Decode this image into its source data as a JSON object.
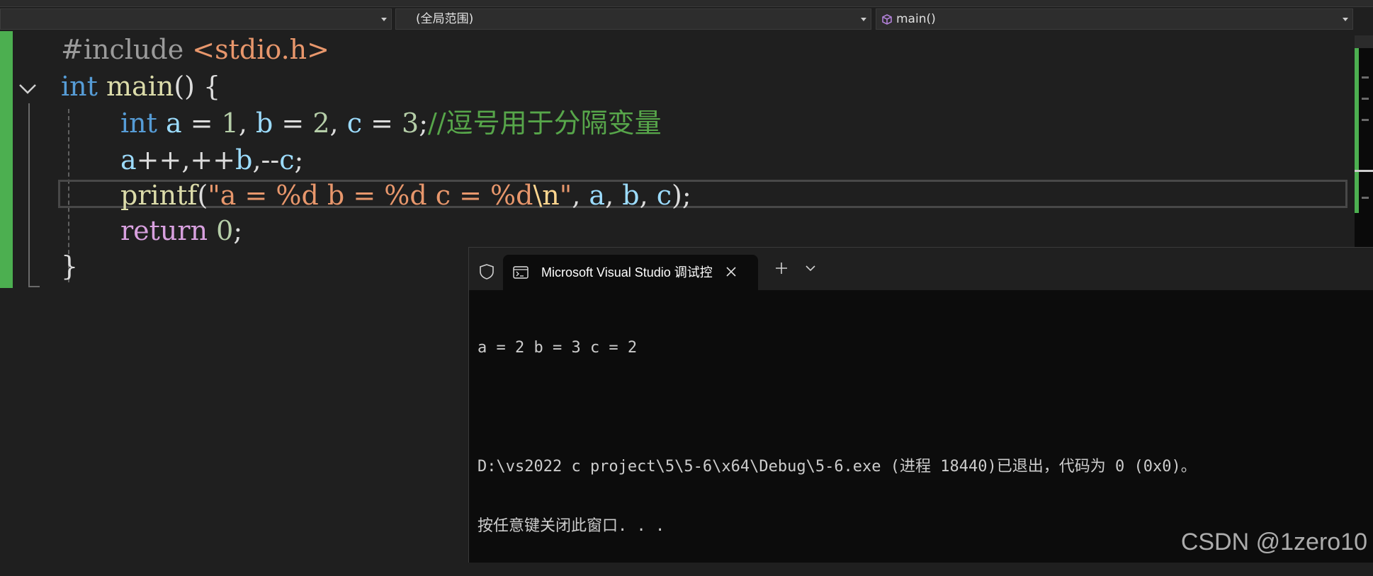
{
  "navbar": {
    "project_combo": "",
    "scope_combo": "(全局范围)",
    "member_combo": "main()"
  },
  "editor": {
    "lines": [
      {
        "tokens": [
          {
            "t": "#include ",
            "c": "dir"
          },
          {
            "t": "<stdio.h>",
            "c": "inc"
          }
        ]
      },
      {
        "tokens": [
          {
            "t": "int",
            "c": "kw"
          },
          {
            "t": " ",
            "c": "pun"
          },
          {
            "t": "main",
            "c": "fn"
          },
          {
            "t": "() {",
            "c": "pun"
          }
        ]
      },
      {
        "tokens": [
          {
            "t": "int",
            "c": "kw"
          },
          {
            "t": " ",
            "c": "pun"
          },
          {
            "t": "a",
            "c": "var"
          },
          {
            "t": " = ",
            "c": "pun"
          },
          {
            "t": "1",
            "c": "num"
          },
          {
            "t": ", ",
            "c": "pun"
          },
          {
            "t": "b",
            "c": "var"
          },
          {
            "t": " = ",
            "c": "pun"
          },
          {
            "t": "2",
            "c": "num"
          },
          {
            "t": ", ",
            "c": "pun"
          },
          {
            "t": "c",
            "c": "var"
          },
          {
            "t": " = ",
            "c": "pun"
          },
          {
            "t": "3",
            "c": "num"
          },
          {
            "t": ";",
            "c": "pun"
          },
          {
            "t": "//逗号用于分隔变量",
            "c": "cmt"
          }
        ]
      },
      {
        "tokens": [
          {
            "t": "a",
            "c": "var"
          },
          {
            "t": "++,++",
            "c": "pun"
          },
          {
            "t": "b",
            "c": "var"
          },
          {
            "t": ",--",
            "c": "pun"
          },
          {
            "t": "c",
            "c": "var"
          },
          {
            "t": ";",
            "c": "pun"
          }
        ]
      },
      {
        "tokens": [
          {
            "t": "printf",
            "c": "fn"
          },
          {
            "t": "(",
            "c": "pun"
          },
          {
            "t": "\"a = %d b = %d c = %d",
            "c": "str"
          },
          {
            "t": "\\n",
            "c": "esc"
          },
          {
            "t": "\"",
            "c": "str"
          },
          {
            "t": ", ",
            "c": "pun"
          },
          {
            "t": "a",
            "c": "var"
          },
          {
            "t": ", ",
            "c": "pun"
          },
          {
            "t": "b",
            "c": "var"
          },
          {
            "t": ", ",
            "c": "pun"
          },
          {
            "t": "c",
            "c": "var"
          },
          {
            "t": ");",
            "c": "pun"
          }
        ]
      },
      {
        "tokens": [
          {
            "t": "return",
            "c": "ctl"
          },
          {
            "t": " ",
            "c": "pun"
          },
          {
            "t": "0",
            "c": "num"
          },
          {
            "t": ";",
            "c": "pun"
          }
        ]
      },
      {
        "tokens": [
          {
            "t": "}",
            "c": "pun"
          }
        ]
      }
    ]
  },
  "terminal": {
    "tab_title": "Microsoft Visual Studio 调试控",
    "output": [
      "a = 2 b = 3 c = 2",
      "",
      "D:\\vs2022 c project\\5\\5-6\\x64\\Debug\\5-6.exe (进程 18440)已退出，代码为 0 (0x0)。",
      "按任意键关闭此窗口. . ."
    ]
  },
  "watermark": "CSDN @1zero10",
  "colors": {
    "background": "#1f1f1f",
    "change_bar": "#4caf50",
    "keyword": "#569cd6",
    "function": "#dcdcaa",
    "variable": "#9cdcfe",
    "number": "#b5cea8",
    "comment": "#57a64a",
    "string": "#e8976c",
    "control": "#d8a0df",
    "terminal_bg": "#0c0c0c"
  },
  "icons": {
    "fold": "chevron-down-icon",
    "member": "cube-icon",
    "shield": "shield-icon",
    "terminal": "terminal-icon",
    "close": "close-icon",
    "new_tab": "plus-icon",
    "tab_menu": "chevron-down-icon"
  }
}
